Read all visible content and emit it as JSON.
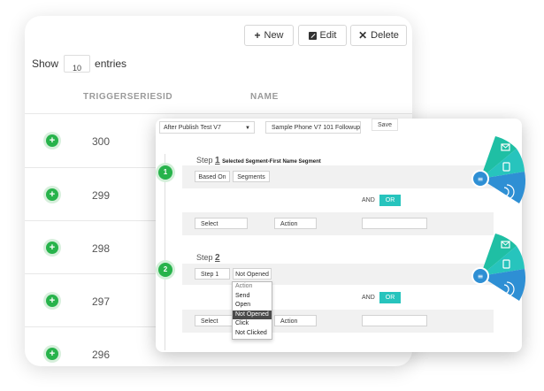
{
  "toolbar": {
    "new_label": "New",
    "edit_label": "Edit",
    "delete_label": "Delete",
    "new_icon": "plus-icon",
    "edit_icon": "edit-icon",
    "delete_icon": "close-icon"
  },
  "table": {
    "show_label": "Show",
    "entries_value": "10",
    "entries_label": "entries",
    "columns": [
      "TRIGGERSERIESID",
      "NAME"
    ],
    "rows": [
      {
        "id": "300"
      },
      {
        "id": "299"
      },
      {
        "id": "298"
      },
      {
        "id": "297"
      },
      {
        "id": "296"
      }
    ]
  },
  "workflow": {
    "trigger_select": "After Publish Test V7",
    "name_input": "Sample Phone V7 101 Followup",
    "save_label": "Save",
    "steps": [
      {
        "number": "1",
        "step_word": "Step",
        "segment_text": "Selected Segment-First Name Segment",
        "based_on_label": "Based On",
        "segments_label": "Segments",
        "and_label": "AND",
        "or_label": "OR",
        "select_label": "Select",
        "action_label": "Action"
      },
      {
        "number": "2",
        "step_word": "Step",
        "step_select": "Step 1",
        "status_select": "Not Opened",
        "and_label": "AND",
        "or_label": "OR",
        "select_label": "Select",
        "action_label": "Action"
      }
    ],
    "dropdown_options": [
      "Action",
      "Send",
      "Open",
      "Not Opened",
      "Click",
      "Not Clicked"
    ],
    "dropdown_selected": "Not Opened"
  },
  "colors": {
    "green": "#27b34b",
    "teal": "#27c4bd",
    "blue": "#2e8fd4"
  }
}
